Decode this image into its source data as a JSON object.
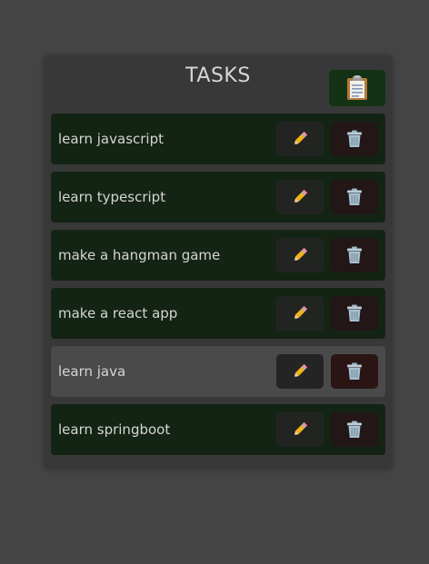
{
  "header": {
    "title": "TASKS",
    "add_icon": "clipboard-icon"
  },
  "tasks": [
    {
      "label": "learn javascript",
      "edit_icon": "pencil-icon",
      "delete_icon": "trash-icon"
    },
    {
      "label": "learn typescript",
      "edit_icon": "pencil-icon",
      "delete_icon": "trash-icon"
    },
    {
      "label": "make a hangman game",
      "edit_icon": "pencil-icon",
      "delete_icon": "trash-icon"
    },
    {
      "label": "make a react app",
      "edit_icon": "pencil-icon",
      "delete_icon": "trash-icon"
    },
    {
      "label": "learn java",
      "edit_icon": "pencil-icon",
      "delete_icon": "trash-icon",
      "state": "hovered"
    },
    {
      "label": "learn springboot",
      "edit_icon": "pencil-icon",
      "delete_icon": "trash-icon"
    }
  ],
  "colors": {
    "background": "#444444",
    "panel": "#383838",
    "task_row": "#142414",
    "task_row_hovered": "#4a4a4a",
    "add_button": "#143214",
    "edit_button": "#222422",
    "delete_button": "#221616",
    "text": "#d4d4d4"
  }
}
